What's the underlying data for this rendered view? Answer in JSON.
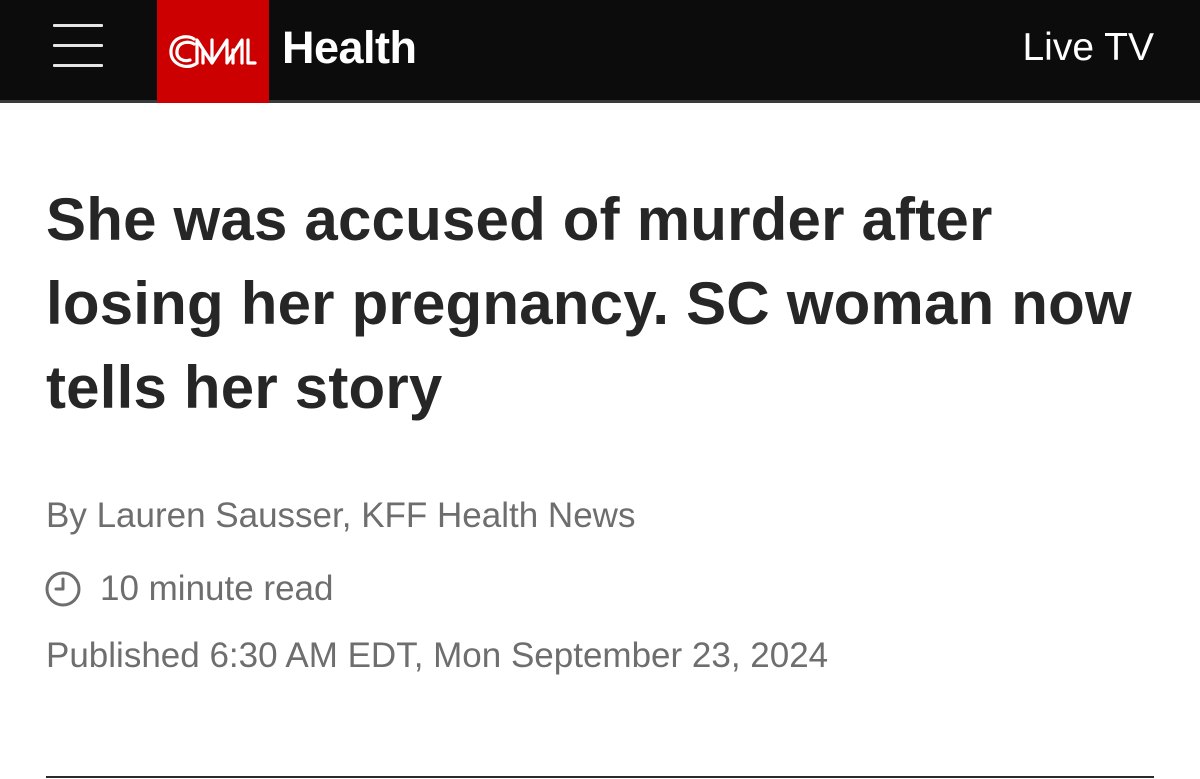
{
  "header": {
    "menu_icon": "hamburger-menu-icon",
    "logo_text": "CNN",
    "section": "Health",
    "live_tv_label": "Live TV",
    "brand_color": "#cc0000",
    "bar_color": "#0c0c0c"
  },
  "article": {
    "headline": "She was accused of murder after losing her pregnancy. SC woman now tells her story",
    "byline_prefix": "By ",
    "byline_author": "Lauren Sausser, KFF Health News",
    "read_time_icon": "clock-icon",
    "read_time": "10 minute read",
    "published": "Published 6:30 AM EDT, Mon September 23, 2024"
  }
}
